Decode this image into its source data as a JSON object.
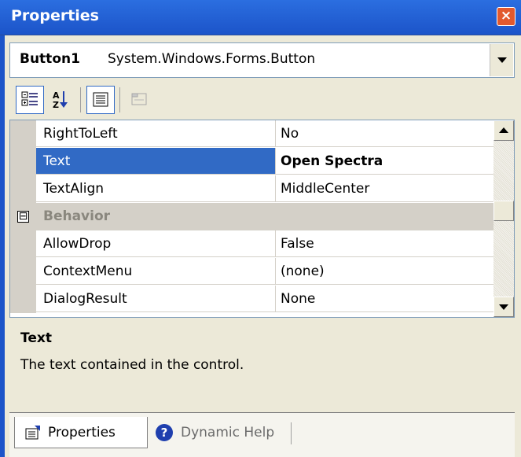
{
  "window": {
    "title": "Properties",
    "close_icon": "close-icon"
  },
  "object_selector": {
    "name": "Button1",
    "type": "System.Windows.Forms.Button"
  },
  "toolbar": {
    "buttons": [
      {
        "icon": "categorized-icon",
        "pressed": true
      },
      {
        "icon": "alphabetical-sort-icon",
        "pressed": false
      },
      {
        "icon": "properties-icon",
        "pressed": true
      },
      {
        "icon": "property-pages-icon",
        "pressed": false,
        "disabled": true
      }
    ]
  },
  "grid": {
    "rows": [
      {
        "kind": "prop",
        "name": "RightToLeft",
        "value": "No"
      },
      {
        "kind": "prop",
        "name": "Text",
        "value": "Open Spectra",
        "selected": true
      },
      {
        "kind": "prop",
        "name": "TextAlign",
        "value": "MiddleCenter"
      },
      {
        "kind": "category",
        "name": "Behavior",
        "expander": "⊟"
      },
      {
        "kind": "prop",
        "name": "AllowDrop",
        "value": "False"
      },
      {
        "kind": "prop",
        "name": "ContextMenu",
        "value": "(none)"
      },
      {
        "kind": "prop",
        "name": "DialogResult",
        "value": "None"
      }
    ]
  },
  "description": {
    "title": "Text",
    "text": "The text contained in the control."
  },
  "tabs": [
    {
      "label": "Properties",
      "icon": "properties-page-icon",
      "active": true
    },
    {
      "label": "Dynamic Help",
      "icon": "help-icon",
      "active": false
    }
  ],
  "colors": {
    "titlebar": "#1c54c9",
    "selection": "#316ac5",
    "category_bg": "#d4d0c8"
  }
}
